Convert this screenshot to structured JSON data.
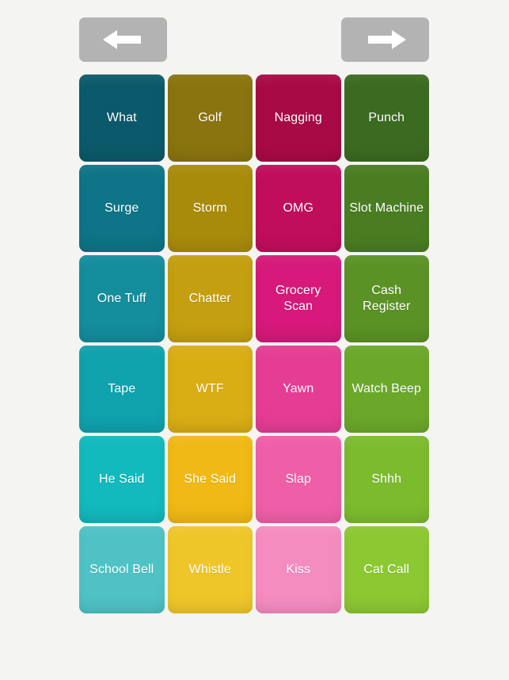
{
  "app": {
    "title": "Soundboard",
    "background_color": "#f4f4f2"
  },
  "nav": {
    "prev": {
      "label": "Previous page",
      "icon": "arrow-left-icon",
      "color": "#b3b3b3",
      "arrow_color": "#ffffff"
    },
    "next": {
      "label": "Next page",
      "icon": "arrow-right-icon",
      "color": "#b3b3b3",
      "arrow_color": "#ffffff"
    }
  },
  "grid": {
    "columns": 4,
    "rows": 6,
    "text_color": "#ffffff",
    "column_colors": [
      [
        "#0b5a6b",
        "#0e7487",
        "#148d9c",
        "#10a2ad",
        "#12b9bd",
        "#4fc2c6"
      ],
      [
        "#8a7410",
        "#a98b0c",
        "#c49f10",
        "#d9ad14",
        "#f0b915",
        "#efc62a"
      ],
      [
        "#a80a45",
        "#c00e5c",
        "#d6197a",
        "#e53d94",
        "#ef5fa8",
        "#f58cc0"
      ],
      [
        "#3b6b20",
        "#4a7d22",
        "#5b9226",
        "#6ba82a",
        "#7cbb2e",
        "#8cc832"
      ]
    ],
    "tiles": [
      {
        "label": "What",
        "color": "#0b5a6b"
      },
      {
        "label": "Golf",
        "color": "#8a7410"
      },
      {
        "label": "Nagging",
        "color": "#a80a45"
      },
      {
        "label": "Punch",
        "color": "#3b6b20"
      },
      {
        "label": "Surge",
        "color": "#0e7487"
      },
      {
        "label": "Storm",
        "color": "#a98b0c"
      },
      {
        "label": "OMG",
        "color": "#c00e5c"
      },
      {
        "label": "Slot Machine",
        "color": "#4a7d22"
      },
      {
        "label": "One Tuff",
        "color": "#148d9c"
      },
      {
        "label": "Chatter",
        "color": "#c49f10"
      },
      {
        "label": "Grocery Scan",
        "color": "#d6197a"
      },
      {
        "label": "Cash Register",
        "color": "#5b9226"
      },
      {
        "label": "Tape",
        "color": "#10a2ad"
      },
      {
        "label": "WTF",
        "color": "#d9ad14"
      },
      {
        "label": "Yawn",
        "color": "#e53d94"
      },
      {
        "label": "Watch Beep",
        "color": "#6ba82a"
      },
      {
        "label": "He Said",
        "color": "#12b9bd"
      },
      {
        "label": "She Said",
        "color": "#f0b915"
      },
      {
        "label": "Slap",
        "color": "#ef5fa8"
      },
      {
        "label": "Shhh",
        "color": "#7cbb2e"
      },
      {
        "label": "School Bell",
        "color": "#4fc2c6"
      },
      {
        "label": "Whistle",
        "color": "#efc62a"
      },
      {
        "label": "Kiss",
        "color": "#f58cc0"
      },
      {
        "label": "Cat Call",
        "color": "#8cc832"
      }
    ]
  }
}
